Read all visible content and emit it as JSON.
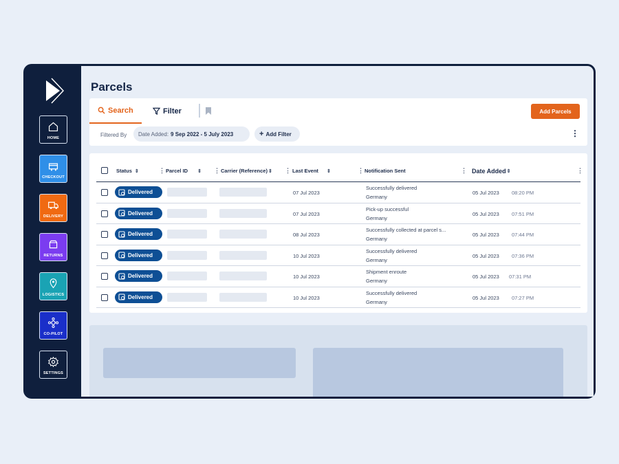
{
  "app": {
    "title": "Parcels"
  },
  "sidebar": {
    "items": [
      {
        "label": "HOME",
        "icon": "home-icon",
        "color": "#0f1f3d"
      },
      {
        "label": "CHECKOUT",
        "icon": "checkout-icon",
        "color": "#2f8fe8"
      },
      {
        "label": "DELIVERY",
        "icon": "delivery-icon",
        "color": "#f06a12"
      },
      {
        "label": "RETURNS",
        "icon": "returns-icon",
        "color": "#7b3cf0"
      },
      {
        "label": "LOGISTICS",
        "icon": "logistics-icon",
        "color": "#1aa3b4"
      },
      {
        "label": "CO-PILOT",
        "icon": "copilot-icon",
        "color": "#1a2fc9"
      },
      {
        "label": "SETTINGS",
        "icon": "gear-icon",
        "color": "#0f1f3d"
      }
    ]
  },
  "toolbar": {
    "search_tab": "Search",
    "filter_tab": "Filter",
    "add_parcels_label": "Add Parcels",
    "filtered_by_label": "Filtered By",
    "date_filter_key": "Date Added:",
    "date_filter_value": "9 Sep 2022 - 5 July 2023",
    "add_filter_label": "Add Filter",
    "accent": "#e3641c"
  },
  "table": {
    "columns": [
      "Status",
      "Parcel ID",
      "Carrier (Reference)",
      "Last Event",
      "Notification Sent",
      "Date Added"
    ],
    "rows": [
      {
        "status": "Delivered",
        "last_event": "07 Jul 2023",
        "notification": "Successfully delivered",
        "country": "Germany",
        "date": "05 Jul 2023",
        "time": "08:20 PM"
      },
      {
        "status": "Delivered",
        "last_event": "07 Jul 2023",
        "notification": "Pick-up successful",
        "country": "Germany",
        "date": "05 Jul 2023",
        "time": "07:51 PM"
      },
      {
        "status": "Delivered",
        "last_event": "08 Jul 2023",
        "notification": "Successfully collected at parcel s...",
        "country": "Germany",
        "date": "05 Jul 2023",
        "time": "07:44 PM"
      },
      {
        "status": "Delivered",
        "last_event": "10 Jul 2023",
        "notification": "Successfully delivered",
        "country": "Germany",
        "date": "05 Jul 2023",
        "time": "07:36 PM"
      },
      {
        "status": "Delivered",
        "last_event": "10 Jul 2023",
        "notification": "Shipment enroute",
        "country": "Germany",
        "date": "05 Jul 2023",
        "time": "07:31 PM"
      },
      {
        "status": "Delivered",
        "last_event": "10 Jul 2023",
        "notification": "Successfully delivered",
        "country": "Germany",
        "date": "05 Jul 2023",
        "time": "07:27 PM"
      }
    ],
    "status_color": "#0e4f95"
  }
}
